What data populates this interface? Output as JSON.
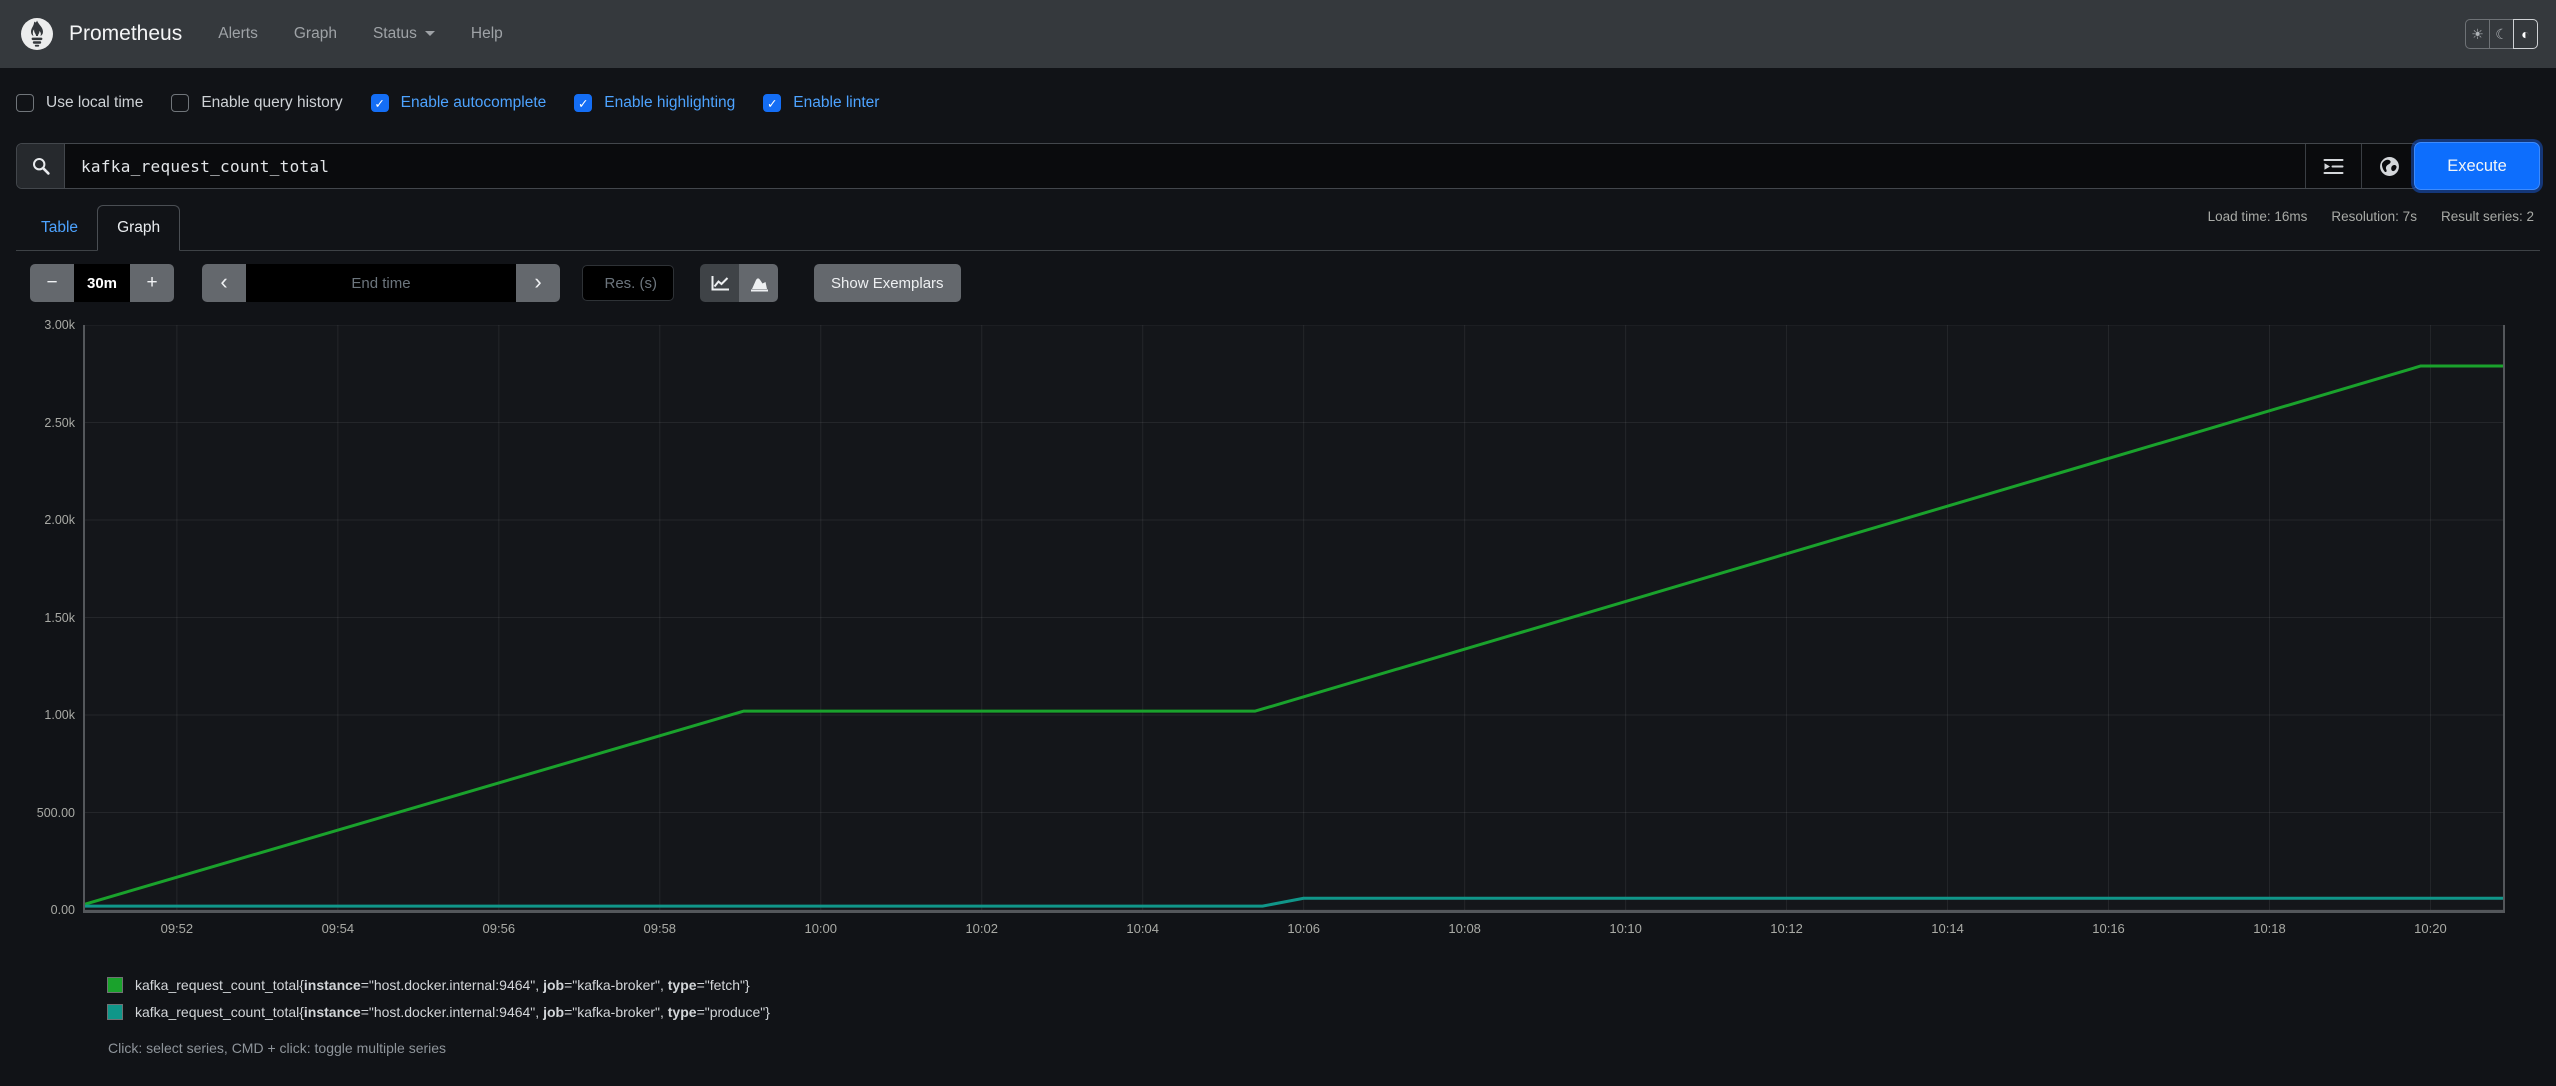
{
  "navbar": {
    "brand": "Prometheus",
    "items": [
      {
        "label": "Alerts",
        "caret": false
      },
      {
        "label": "Graph",
        "caret": false
      },
      {
        "label": "Status",
        "caret": true
      },
      {
        "label": "Help",
        "caret": false
      }
    ],
    "theme_buttons": [
      {
        "name": "light",
        "icon": "sun-icon",
        "active": false
      },
      {
        "name": "dark",
        "icon": "moon-icon",
        "active": false
      },
      {
        "name": "auto",
        "icon": "adjust-icon",
        "active": true
      }
    ]
  },
  "options": [
    {
      "label": "Use local time",
      "checked": false
    },
    {
      "label": "Enable query history",
      "checked": false
    },
    {
      "label": "Enable autocomplete",
      "checked": true
    },
    {
      "label": "Enable highlighting",
      "checked": true
    },
    {
      "label": "Enable linter",
      "checked": true
    }
  ],
  "query": {
    "value": "kafka_request_count_total",
    "execute_label": "Execute"
  },
  "tabs": {
    "table": "Table",
    "graph": "Graph"
  },
  "stats": {
    "load_time": "Load time: 16ms",
    "resolution": "Resolution: 7s",
    "result_series": "Result series: 2"
  },
  "controls": {
    "range_value": "30m",
    "end_time_placeholder": "End time",
    "res_placeholder": "Res. (s)",
    "show_exemplars": "Show Exemplars"
  },
  "icons": {
    "minus": "−",
    "plus": "+",
    "chevron_left": "‹",
    "chevron_right": "›",
    "sun": "☀",
    "moon": "☾",
    "adjust": "◐",
    "check": "✓"
  },
  "chart_data": {
    "type": "line",
    "title": "kafka_request_count_total over time",
    "x_ticks": [
      "09:52",
      "09:54",
      "09:56",
      "09:58",
      "10:00",
      "10:02",
      "10:04",
      "10:06",
      "10:08",
      "10:10",
      "10:12",
      "10:14",
      "10:16",
      "10:18",
      "10:20"
    ],
    "x_axis": {
      "first_tick_frac": 0.038,
      "last_tick_frac": 0.97
    },
    "y_ticks": [
      {
        "label": "0.00",
        "value": 0
      },
      {
        "label": "500.00",
        "value": 500
      },
      {
        "label": "1.00k",
        "value": 1000
      },
      {
        "label": "1.50k",
        "value": 1500
      },
      {
        "label": "2.00k",
        "value": 2000
      },
      {
        "label": "2.50k",
        "value": 2500
      },
      {
        "label": "3.00k",
        "value": 3000
      }
    ],
    "ylim": [
      0,
      3000
    ],
    "grid": true,
    "legend_position": "bottom",
    "series": [
      {
        "name": "kafka_request_count_total{type=\"fetch\"}",
        "color": "#1aa22c",
        "points": [
          [
            0,
            30
          ],
          [
            0.2725,
            1020
          ],
          [
            0.484,
            1020
          ],
          [
            0.966,
            2790
          ],
          [
            1,
            2790
          ]
        ]
      },
      {
        "name": "kafka_request_count_total{type=\"produce\"}",
        "color": "#109689",
        "points": [
          [
            0,
            20
          ],
          [
            0.487,
            20
          ],
          [
            0.504,
            60
          ],
          [
            1,
            60
          ]
        ]
      }
    ]
  },
  "legend": {
    "series": [
      {
        "color": "#1aa22c",
        "metric": "kafka_request_count_total",
        "labels": [
          {
            "name": "instance",
            "value": "host.docker.internal:9464"
          },
          {
            "name": "job",
            "value": "kafka-broker"
          },
          {
            "name": "type",
            "value": "fetch"
          }
        ]
      },
      {
        "color": "#109689",
        "metric": "kafka_request_count_total",
        "labels": [
          {
            "name": "instance",
            "value": "host.docker.internal:9464"
          },
          {
            "name": "job",
            "value": "kafka-broker"
          },
          {
            "name": "type",
            "value": "produce"
          }
        ]
      }
    ],
    "hint": "Click: select series, CMD + click: toggle multiple series"
  },
  "colors": {
    "accent": "#0d6efd",
    "link": "#4da3ff",
    "series_fetch": "#1aa22c",
    "series_produce": "#109689",
    "navbar_bg": "#35393d",
    "page_bg": "#111317"
  }
}
